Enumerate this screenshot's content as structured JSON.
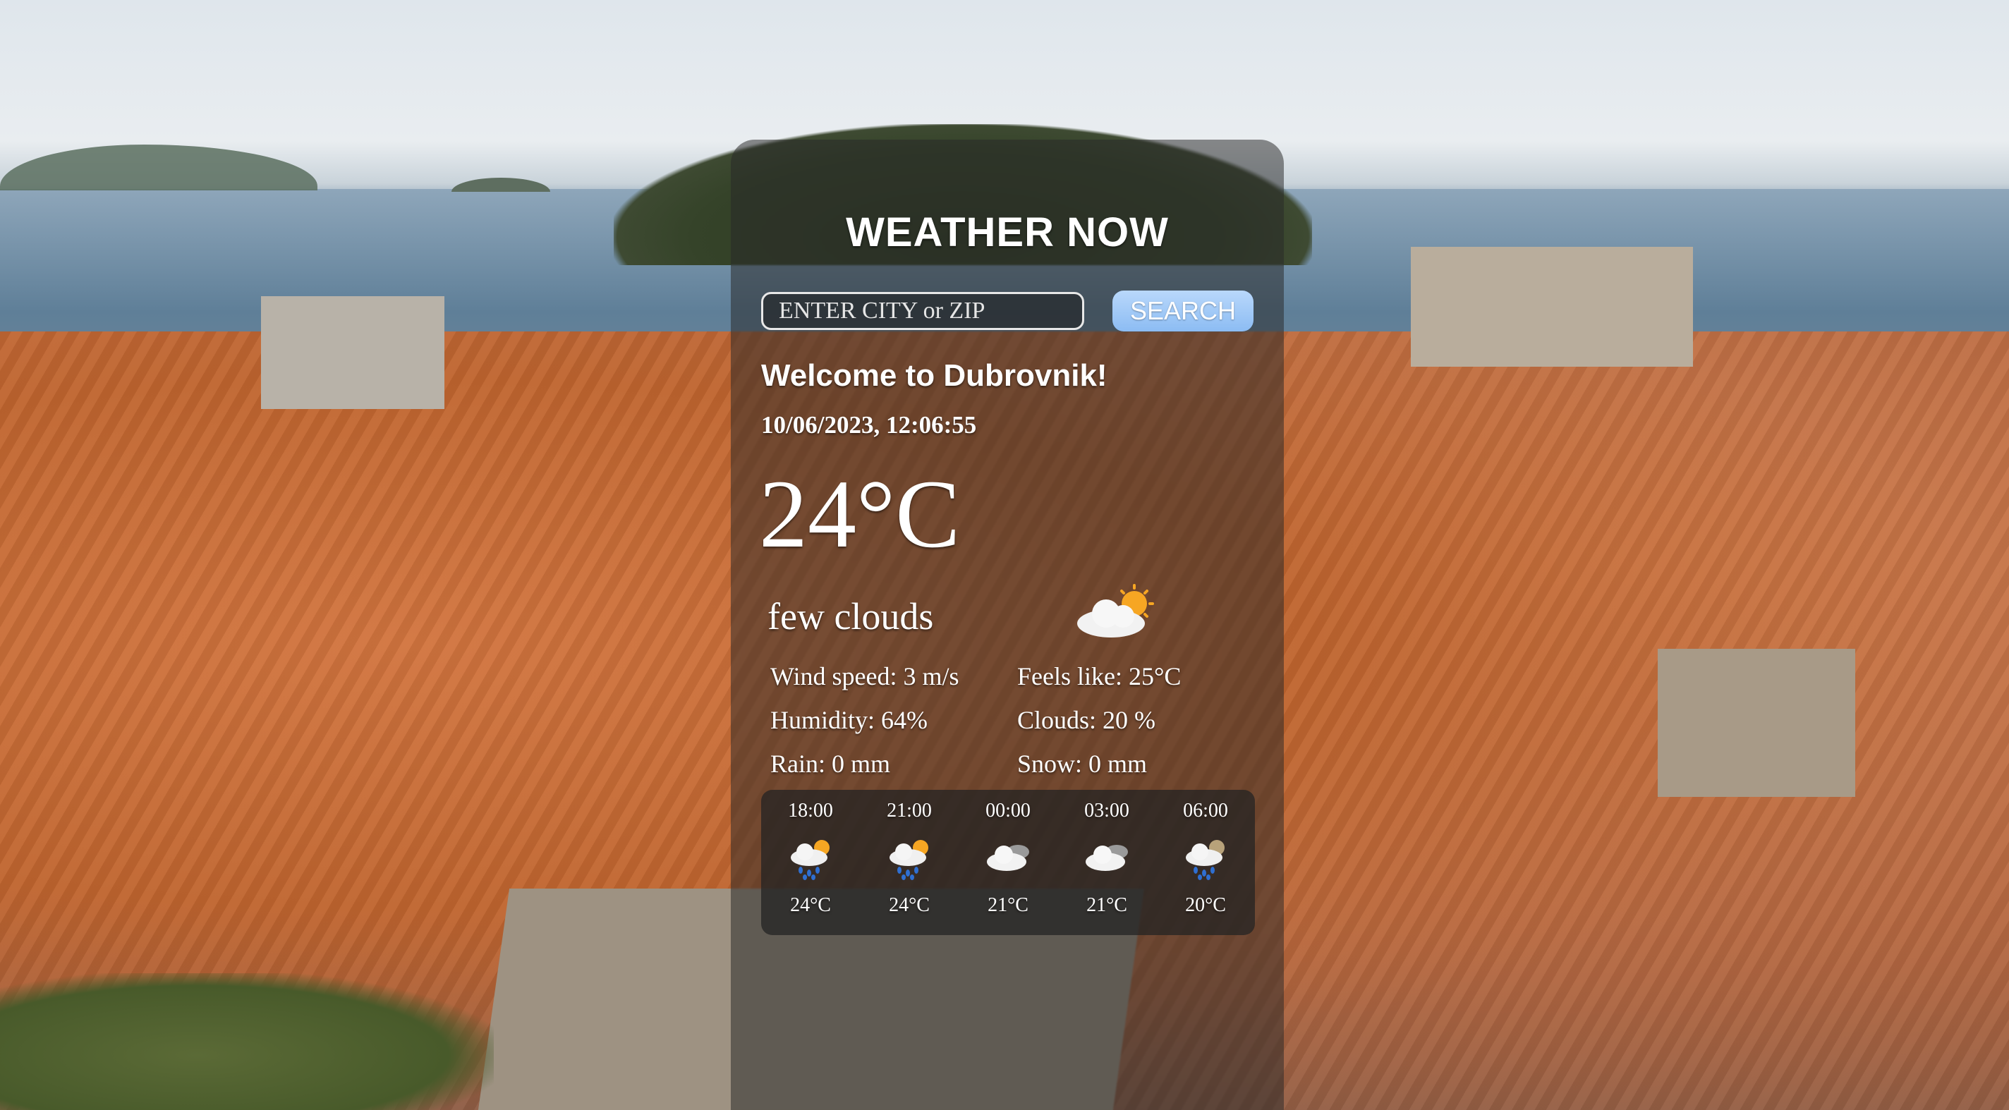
{
  "app": {
    "title": "WEATHER NOW"
  },
  "search": {
    "placeholder": "ENTER CITY or ZIP",
    "button_label": "SEARCH"
  },
  "current": {
    "welcome": "Welcome to Dubrovnik!",
    "datetime": "10/06/2023, 12:06:55",
    "temperature": "24°C",
    "description": "few clouds",
    "icon": "sun-cloud-icon",
    "details": {
      "wind": "Wind speed: 3 m/s",
      "feels_like": "Feels like: 25°C",
      "humidity": "Humidity: 64%",
      "clouds": "Clouds: 20 %",
      "rain": "Rain: 0 mm",
      "snow": "Snow: 0 mm"
    }
  },
  "forecast": [
    {
      "time": "18:00",
      "temp": "24°C",
      "icon": "rain-sun-icon"
    },
    {
      "time": "21:00",
      "temp": "24°C",
      "icon": "rain-sun-icon"
    },
    {
      "time": "00:00",
      "temp": "21°C",
      "icon": "cloud-icon"
    },
    {
      "time": "03:00",
      "temp": "21°C",
      "icon": "cloud-icon"
    },
    {
      "time": "06:00",
      "temp": "20°C",
      "icon": "rain-cloud-icon"
    }
  ]
}
